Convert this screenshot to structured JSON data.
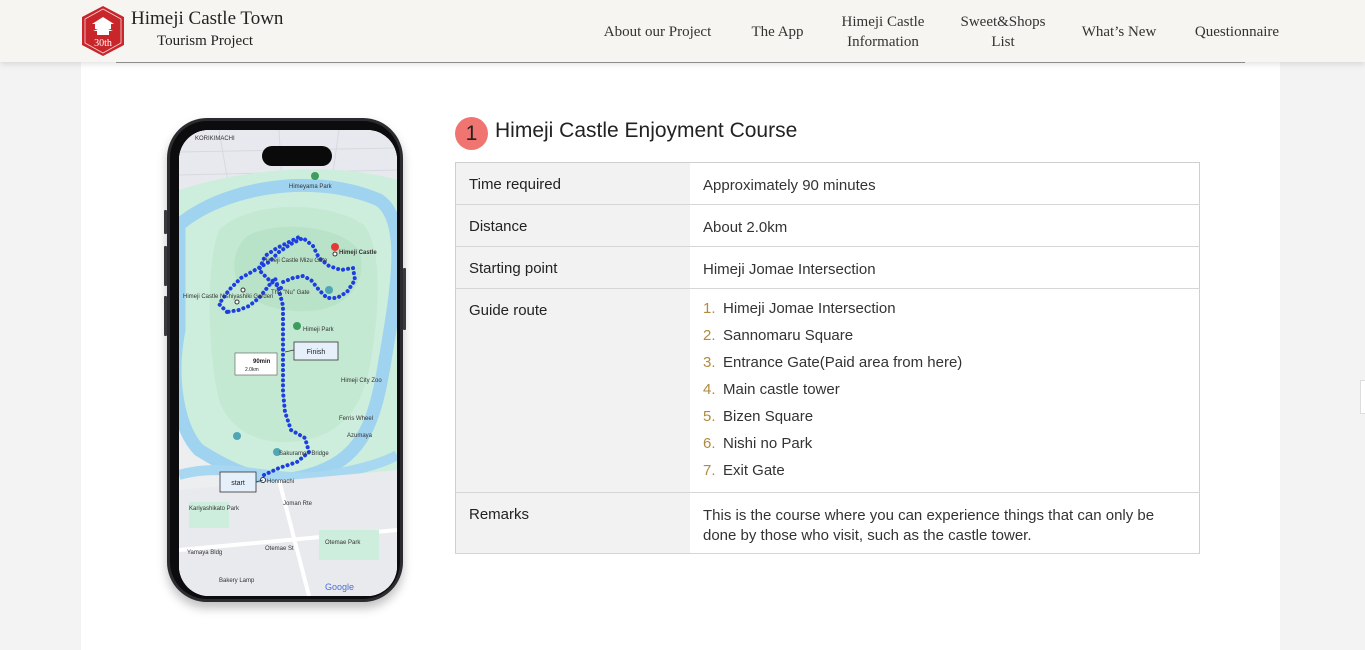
{
  "header": {
    "logo_badge": "30th",
    "brand_line1": "Himeji Castle Town",
    "brand_line2": "Tourism Project",
    "nav": [
      {
        "label": "About our Project"
      },
      {
        "label": "The App"
      },
      {
        "label": "Himeji Castle\nInformation"
      },
      {
        "label": "Sweet&Shops\nList"
      },
      {
        "label": "What’s New"
      },
      {
        "label": "Questionnaire"
      }
    ]
  },
  "map": {
    "labels": {
      "korikimachi": "KORIKIMACHI",
      "himeyama_park": "Himeyama Park",
      "himeji_castle": "Himeji Castle",
      "mizu_gate": "Himeji Castle Mizu Gate",
      "nu_gate": "The \"Nu\" Gate",
      "garden": "Himeji Castle Nishiyashiki Garden",
      "himeji_park": "Himeji Park",
      "city_zoo": "Himeji City Zoo",
      "ferris": "Ferris Wheel",
      "azumaya": "Azumaya",
      "sakuramon": "Sakuramon Bridge",
      "honmachi": "Honmachi",
      "ohtemae_st": "Otemae St",
      "joman": "Joman Rte",
      "kariyashikato": "Kariyashikato Park",
      "otemae_park": "Otemae Park",
      "yamaya": "Yamaya Bldg",
      "bakery": "Bakery Lamp",
      "google": "Google"
    },
    "finish_label": "Finish",
    "start_label": "start",
    "duration_label": "90min",
    "distance_label": "2.0km"
  },
  "course": {
    "number": "1",
    "title": "Himeji Castle Enjoyment Course",
    "rows": {
      "time": {
        "label": "Time required",
        "value": "Approximately 90 minutes"
      },
      "distance": {
        "label": "Distance",
        "value": "About 2.0km"
      },
      "start": {
        "label": "Starting point",
        "value": "Himeji Jomae Intersection"
      },
      "route_label": "Guide route",
      "remarks": {
        "label": "Remarks",
        "value": "This is the course where you can experience things that can only be done by those who visit, such as the castle tower."
      }
    },
    "route": [
      {
        "num": "1.",
        "name": "Himeji Jomae Intersection"
      },
      {
        "num": "2.",
        "name": "Sannomaru Square"
      },
      {
        "num": "3.",
        "name": "Entrance Gate(Paid area from here)"
      },
      {
        "num": "4.",
        "name": "Main castle tower"
      },
      {
        "num": "5.",
        "name": "Bizen Square"
      },
      {
        "num": "6.",
        "name": "Nishi no Park"
      },
      {
        "num": "7.",
        "name": "Exit Gate"
      }
    ]
  },
  "colors": {
    "badge": "#f07470",
    "route_dot": "#1d3fe0",
    "route_number": "#b08a3e",
    "header_bg": "#f6f5f1",
    "logo_red": "#c8262a"
  }
}
